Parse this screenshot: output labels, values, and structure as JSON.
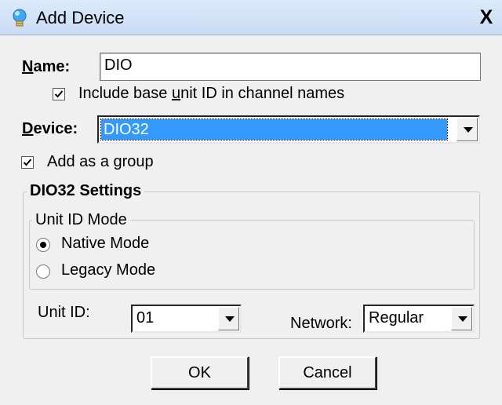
{
  "window": {
    "title": "Add Device",
    "close_label": "X"
  },
  "name": {
    "label_first": "N",
    "label_rest": "ame:",
    "value": "DIO"
  },
  "include_base_unit": {
    "label_pre": "Include base ",
    "label_underline": "u",
    "label_post": "nit ID in channel names",
    "checked": true
  },
  "device": {
    "label_first": "D",
    "label_rest": "evice:",
    "value": "DIO32"
  },
  "add_as_group": {
    "label_pre": "Add as a ",
    "label_underline": "g",
    "label_post": "roup",
    "checked": true
  },
  "settings": {
    "title": "DIO32 Settings",
    "unit_id_mode": {
      "title": "Unit ID Mode",
      "options": [
        "Native Mode",
        "Legacy Mode"
      ],
      "selected": "Native Mode"
    },
    "unit_id": {
      "label": "Unit ID:",
      "value": "01"
    },
    "network": {
      "label": "Network:",
      "value": "Regular"
    }
  },
  "buttons": {
    "ok": "OK",
    "cancel": "Cancel"
  },
  "colors": {
    "selection": "#3399ff",
    "titlebar": "#c8dcf3"
  }
}
